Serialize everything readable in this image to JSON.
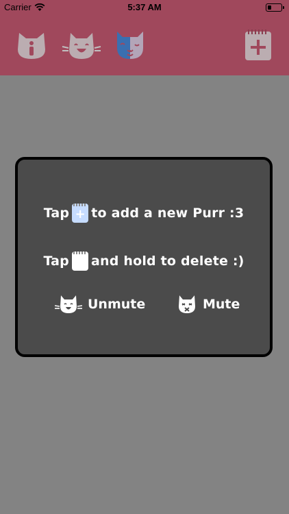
{
  "status": {
    "carrier": "Carrier",
    "time": "5:37 AM"
  },
  "toolbar": {
    "icons": [
      "info-cat-icon",
      "happy-cat-icon",
      "theater-cat-icon",
      "add-notepad-icon"
    ]
  },
  "dialog": {
    "line1": {
      "before": "Tap",
      "after": "to add a new Purr :3"
    },
    "line2": {
      "before": "Tap",
      "after": "and hold to delete :)"
    },
    "unmute_label": "Unmute",
    "mute_label": "Mute"
  },
  "colors": {
    "header": "#a0485c",
    "background": "#838383",
    "dialog": "#4b4b4b",
    "pad_blue": "#c6dcff"
  }
}
